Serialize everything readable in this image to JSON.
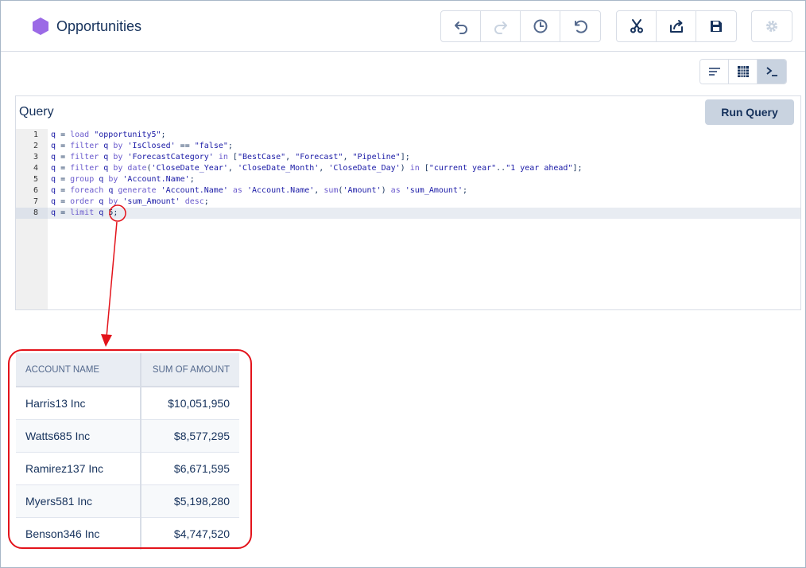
{
  "header": {
    "title": "Opportunities",
    "app_icon_color": "#9b6ae6"
  },
  "toolbar": {
    "groups": [
      [
        "undo-icon",
        "redo-icon",
        "history-icon",
        "reset-icon"
      ],
      [
        "cut-icon",
        "share-icon",
        "save-icon"
      ],
      [
        "gear-icon"
      ]
    ]
  },
  "view_toggles": [
    "chart-view-icon",
    "table-view-icon",
    "query-view-icon"
  ],
  "query": {
    "label": "Query",
    "run_label": "Run Query",
    "lines": [
      {
        "n": "1",
        "text": "q = load \"opportunity5\";"
      },
      {
        "n": "2",
        "text": "q = filter q by 'IsClosed' == \"false\";"
      },
      {
        "n": "3",
        "text": "q = filter q by 'ForecastCategory' in [\"BestCase\", \"Forecast\", \"Pipeline\"];"
      },
      {
        "n": "4",
        "text": "q = filter q by date('CloseDate_Year', 'CloseDate_Month', 'CloseDate_Day') in [\"current year\"..\"1 year ahead\"];"
      },
      {
        "n": "5",
        "text": "q = group q by 'Account.Name';"
      },
      {
        "n": "6",
        "text": "q = foreach q generate 'Account.Name' as 'Account.Name', sum('Amount') as 'sum_Amount';"
      },
      {
        "n": "7",
        "text": "q = order q by 'sum_Amount' desc;"
      },
      {
        "n": "8",
        "text": "q = limit q 5;"
      }
    ]
  },
  "results": {
    "columns": [
      "ACCOUNT NAME",
      "SUM OF AMOUNT"
    ],
    "rows": [
      [
        "Harris13 Inc",
        "$10,051,950"
      ],
      [
        "Watts685 Inc",
        "$8,577,295"
      ],
      [
        "Ramirez137 Inc",
        "$6,671,595"
      ],
      [
        "Myers581 Inc",
        "$5,198,280"
      ],
      [
        "Benson346 Inc",
        "$4,747,520"
      ]
    ]
  },
  "colors": {
    "annotation": "#e3131b",
    "accent_text": "#16325c"
  }
}
